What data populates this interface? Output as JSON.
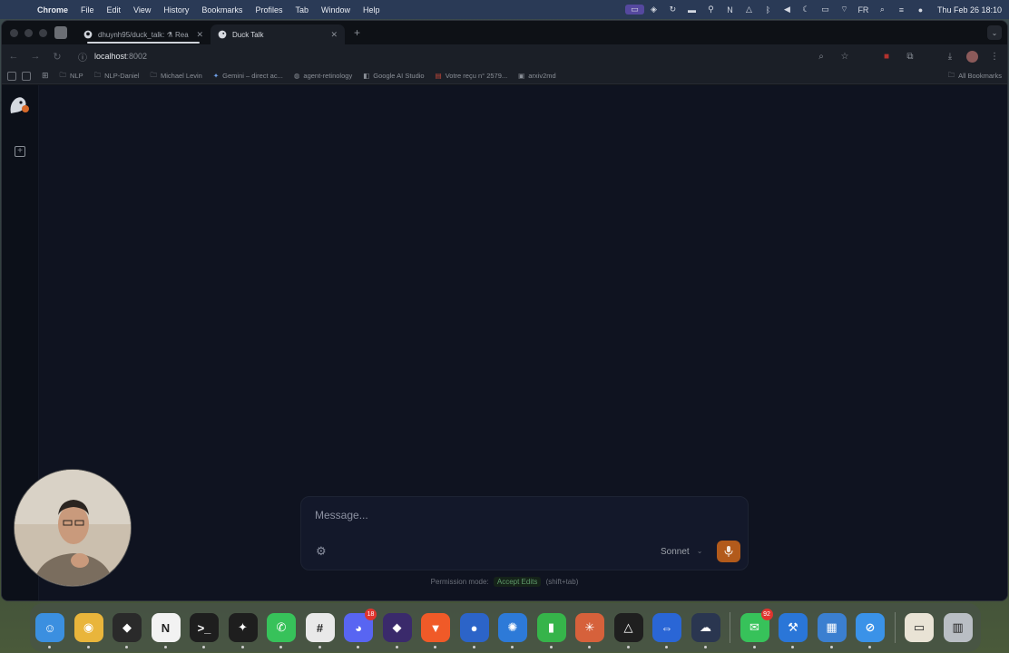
{
  "menubar": {
    "app_name": "Chrome",
    "menus": [
      "File",
      "Edit",
      "View",
      "History",
      "Bookmarks",
      "Profiles",
      "Tab",
      "Window",
      "Help"
    ],
    "clock": "Thu Feb 26  18:10",
    "input_source": "FR"
  },
  "browser": {
    "tabs": [
      {
        "title": "dhuynh95/duck_talk: ⚗ Rea",
        "icon": "github-icon",
        "active": false
      },
      {
        "title": "Duck Talk",
        "icon": "duck-icon",
        "active": true
      }
    ],
    "new_tab_glyph": "+",
    "url": {
      "host": "localhost",
      "port": ":8002"
    },
    "bookmarks": [
      {
        "label": "NLP",
        "icon": "folder-icon"
      },
      {
        "label": "NLP-Daniel",
        "icon": "folder-icon"
      },
      {
        "label": "Michael Levin",
        "icon": "folder-icon"
      },
      {
        "label": "Gemini – direct ac...",
        "icon": "gemini-icon"
      },
      {
        "label": "agent-retinology",
        "icon": "globe-icon"
      },
      {
        "label": "Google AI Studio",
        "icon": "ai-studio-icon"
      },
      {
        "label": "Votre reçu n° 2579...",
        "icon": "receipt-icon"
      },
      {
        "label": "arxiv2md",
        "icon": "arxiv-icon"
      }
    ],
    "all_bookmarks_label": "All Bookmarks"
  },
  "app": {
    "composer": {
      "placeholder": "Message...",
      "model_label": "Sonnet"
    },
    "permission": {
      "prefix": "Permission mode:",
      "mode": "Accept Edits",
      "shortcut": "(shift+tab)"
    }
  },
  "dock": {
    "apps": [
      {
        "name": "finder",
        "color": "#3b8fe0",
        "glyph": "☺"
      },
      {
        "name": "chrome",
        "color": "#e9b53b",
        "glyph": "◉"
      },
      {
        "name": "cube-app",
        "color": "#2a2a2a",
        "glyph": "◆"
      },
      {
        "name": "notion",
        "color": "#f2f2f2",
        "glyph": "N"
      },
      {
        "name": "terminal",
        "color": "#1e1e1e",
        "glyph": ">_"
      },
      {
        "name": "figma",
        "color": "#1e1e1e",
        "glyph": "✦"
      },
      {
        "name": "whatsapp",
        "color": "#37c25a",
        "glyph": "✆"
      },
      {
        "name": "slack",
        "color": "#e9e9e9",
        "glyph": "#"
      },
      {
        "name": "discord",
        "color": "#5865f2",
        "glyph": "◕",
        "badge": "18"
      },
      {
        "name": "obsidian",
        "color": "#3a2a6b",
        "glyph": "◆"
      },
      {
        "name": "brave",
        "color": "#f05a28",
        "glyph": "▼"
      },
      {
        "name": "db-app",
        "color": "#2c64c8",
        "glyph": "●"
      },
      {
        "name": "gear-app",
        "color": "#2d7ad8",
        "glyph": "✺"
      },
      {
        "name": "numbers",
        "color": "#36b44a",
        "glyph": "▮"
      },
      {
        "name": "claude",
        "color": "#d6613b",
        "glyph": "✳"
      },
      {
        "name": "vector-app",
        "color": "#1f1f1f",
        "glyph": "△"
      },
      {
        "name": "teamviewer",
        "color": "#2a66d6",
        "glyph": "⇔"
      },
      {
        "name": "cloud-app",
        "color": "#2a3650",
        "glyph": "☁"
      },
      {
        "name": "messages",
        "color": "#37c25a",
        "glyph": "✉",
        "badge": "92"
      },
      {
        "name": "xcode",
        "color": "#2a76d8",
        "glyph": "⚒"
      },
      {
        "name": "windows-app",
        "color": "#3b7fd0",
        "glyph": "▦"
      },
      {
        "name": "safari",
        "color": "#3a92e8",
        "glyph": "⊘"
      },
      {
        "name": "files",
        "color": "#e9e3d5",
        "glyph": "▭"
      },
      {
        "name": "trash",
        "color": "#b9bec4",
        "glyph": "▥"
      }
    ]
  },
  "colors": {
    "accent_mic": "#b25a1b",
    "permission_green": "#5f9a6b",
    "page_bg": "#0f1320"
  }
}
